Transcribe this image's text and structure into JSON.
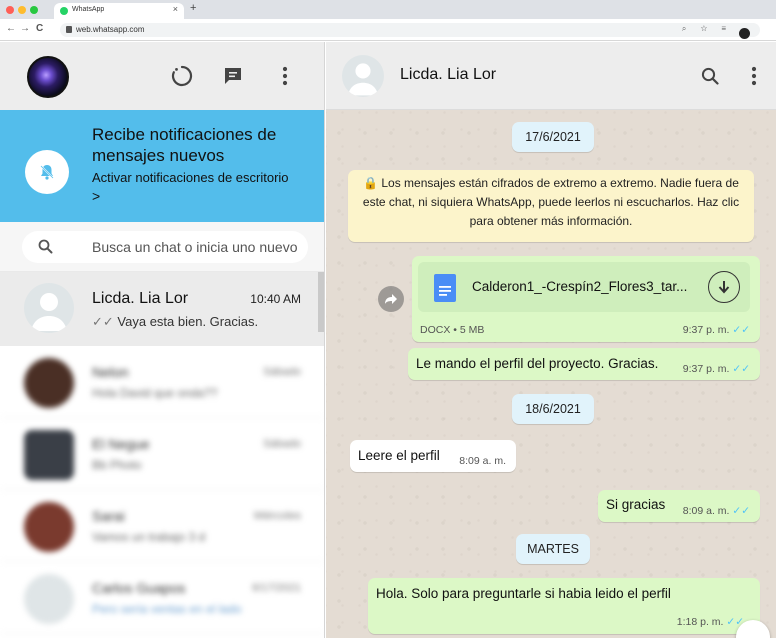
{
  "browser": {
    "tab_title": "WhatsApp",
    "tab_close": "×",
    "new_tab": "+",
    "url": "web.whatsapp.com",
    "nav": {
      "back": "←",
      "forward": "→",
      "reload": "C"
    },
    "omnibox_icons": "⌕ ☆ ≡"
  },
  "sidebar": {
    "notification": {
      "title": "Recibe notificaciones de mensajes nuevos",
      "action": "Activar notificaciones de escritorio",
      "arrow": ">"
    },
    "search": {
      "placeholder": "Busca un chat o inicia uno nuevo"
    },
    "active_chat": {
      "name": "Licda. Lia Lor",
      "time": "10:40 AM",
      "preview": "Vaya esta bien. Gracias."
    },
    "blurred_chats": [
      {
        "name": "Nelon",
        "time": "Sábado",
        "preview": "Hola David que onda??"
      },
      {
        "name": "El Negue",
        "time": "Sábado",
        "preview": "Bb Photo"
      },
      {
        "name": "Sarai",
        "time": "Miércoles",
        "preview": "Vamos un trabajo 3 d"
      },
      {
        "name": "Carlos Guapos",
        "time": "6/17/2021",
        "preview": "Pero sería ventas en el lado"
      }
    ]
  },
  "chat": {
    "contact_name": "Licda. Lia Lor",
    "date_1": "17/6/2021",
    "encryption_notice": "🔒 Los mensajes están cifrados de extremo a extremo. Nadie fuera de este chat, ni siquiera WhatsApp, puede leerlos ni escucharlos. Haz clic para obtener más información.",
    "document": {
      "file_name": "Calderon1_-Crespín2_Flores3_tar...",
      "file_info": "DOCX • 5 MB",
      "time": "9:37 p. m."
    },
    "msg_profile": {
      "text": "Le mando el perfil del proyecto. Gracias.",
      "time": "9:37 p. m."
    },
    "date_2": "18/6/2021",
    "msg_leere": {
      "text": "Leere el perfil",
      "time": "8:09 a. m."
    },
    "msg_si": {
      "text": "Si gracias",
      "time": "8:09 a. m."
    },
    "date_3": "MARTES",
    "msg_hola": {
      "text": "Hola. Solo para preguntarle si habia leido el perfil",
      "time": "1:18 p. m."
    },
    "read_ticks": "✓✓",
    "scroll_down_glyph": "⌄"
  },
  "colors": {
    "notif_banner": "#53bdeb",
    "outgoing_bubble": "#dcf8c6",
    "incoming_bubble": "#ffffff",
    "chat_wallpaper": "#e4dcd3",
    "read_tick": "#4fc3f7",
    "doc_icon": "#4a8df6"
  },
  "icons": {
    "left_header": [
      "status-icon",
      "new-chat-icon",
      "menu-icon"
    ],
    "right_header": [
      "search-icon",
      "menu-icon"
    ],
    "notification": "bell-off-icon",
    "document": [
      "docx-file-icon",
      "download-icon"
    ],
    "forward": "forward-icon"
  }
}
